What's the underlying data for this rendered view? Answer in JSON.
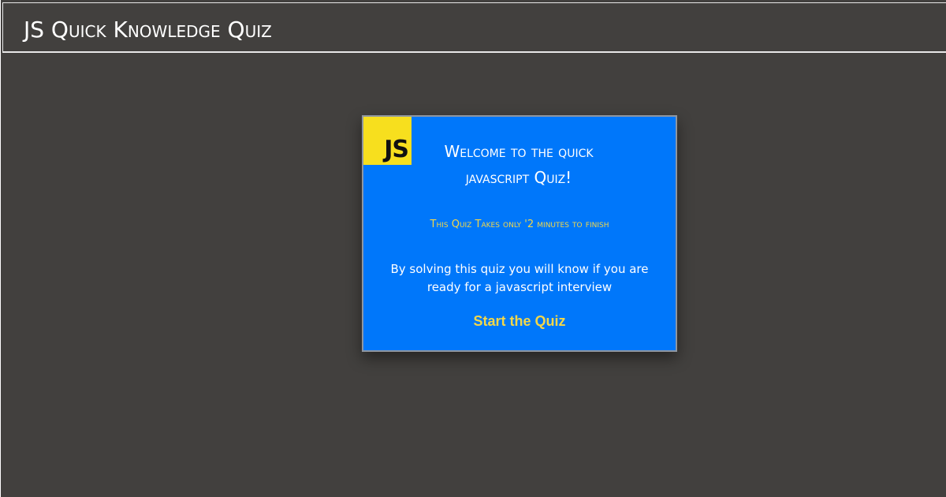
{
  "app": {
    "title": "JS Quick Knowledge Quiz"
  },
  "card": {
    "logo_text": "JS",
    "heading": "Welcome to the quick javascript Quiz!",
    "duration_text": "This Quiz Takes only '2 minutes to finish",
    "description": "By solving this quiz you will know if you are ready for a javascript interview",
    "start_button_label": "Start the Quiz"
  },
  "colors": {
    "page_background": "#42403e",
    "card_background": "#0077fa",
    "logo_background": "#f7df1e",
    "accent_yellow": "#f2d74a",
    "text_white": "#ffffff"
  },
  "icons": {
    "logo": "javascript-logo-icon"
  }
}
